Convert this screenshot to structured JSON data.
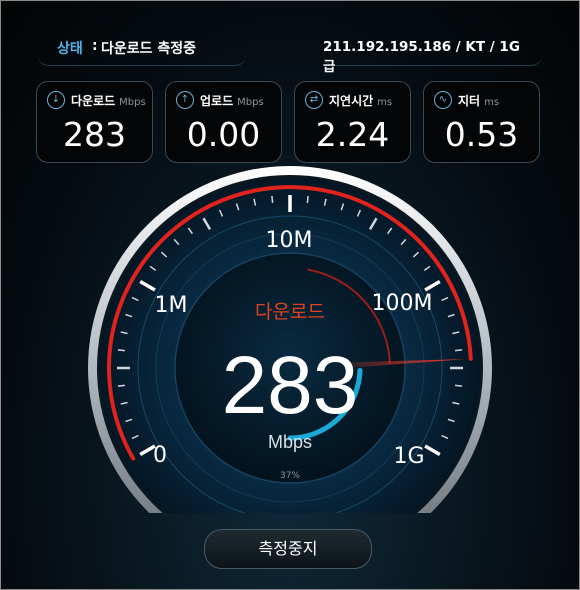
{
  "status": {
    "label": "상태",
    "separator": ":",
    "value": "다운로드 측정중"
  },
  "connection": {
    "info": "211.192.195.186 / KT / 1G급"
  },
  "cards": [
    {
      "title": "다운로드",
      "unit": "Mbps",
      "value": "283",
      "icon": "download-icon"
    },
    {
      "title": "업로드",
      "unit": "Mbps",
      "value": "0.00",
      "icon": "upload-icon"
    },
    {
      "title": "지연시간",
      "unit": "ms",
      "value": "2.24",
      "icon": "latency-icon"
    },
    {
      "title": "지터",
      "unit": "ms",
      "value": "0.53",
      "icon": "jitter-icon"
    }
  ],
  "gauge": {
    "mode_label": "다운로드",
    "value": "283",
    "unit": "Mbps",
    "scale_labels": [
      "0",
      "1M",
      "10M",
      "100M",
      "1G"
    ],
    "progress_label": "37%",
    "progress": 0.37,
    "accent_color": "#e0231c",
    "progress_color": "#19a9d6"
  },
  "stop_button": {
    "label": "측정중지"
  }
}
